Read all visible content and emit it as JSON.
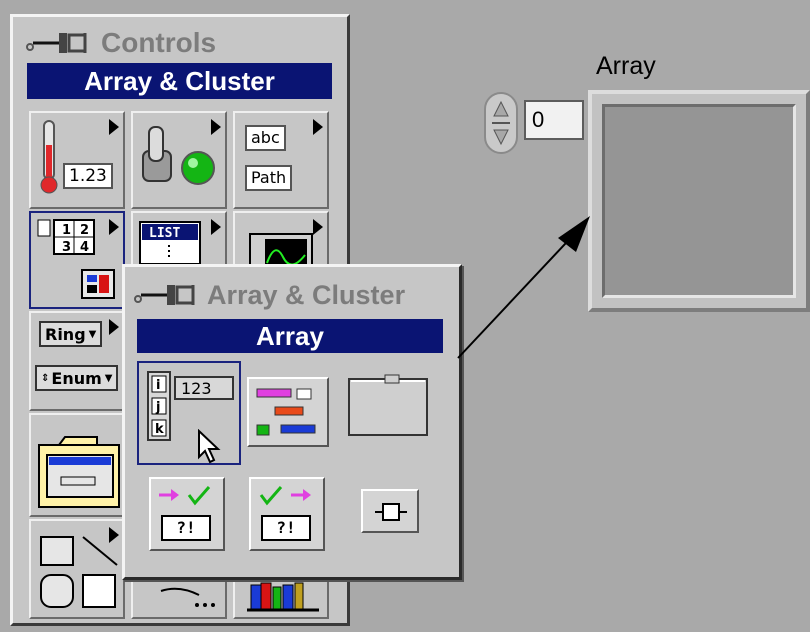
{
  "controls_palette": {
    "title": "Controls",
    "category": "Array & Cluster",
    "numeric_value": "1.23",
    "string_label": "abc",
    "path_label": "Path",
    "list_label": "LIST",
    "ring_label": "Ring",
    "enum_label": "Enum",
    "array_index_labels": [
      "1",
      "2",
      "3",
      "4"
    ]
  },
  "subpalette": {
    "title": "Array & Cluster",
    "category": "Array",
    "array_index_labels": [
      "i",
      "j",
      "k"
    ],
    "array_value": "123",
    "error_labels": [
      "?!",
      "?!"
    ]
  },
  "front_panel": {
    "array_label": "Array",
    "index_value": "0"
  },
  "colors": {
    "header_blue": "#0a1473",
    "palette_gray": "#c6c6c6",
    "background": "#a9a9a9"
  }
}
